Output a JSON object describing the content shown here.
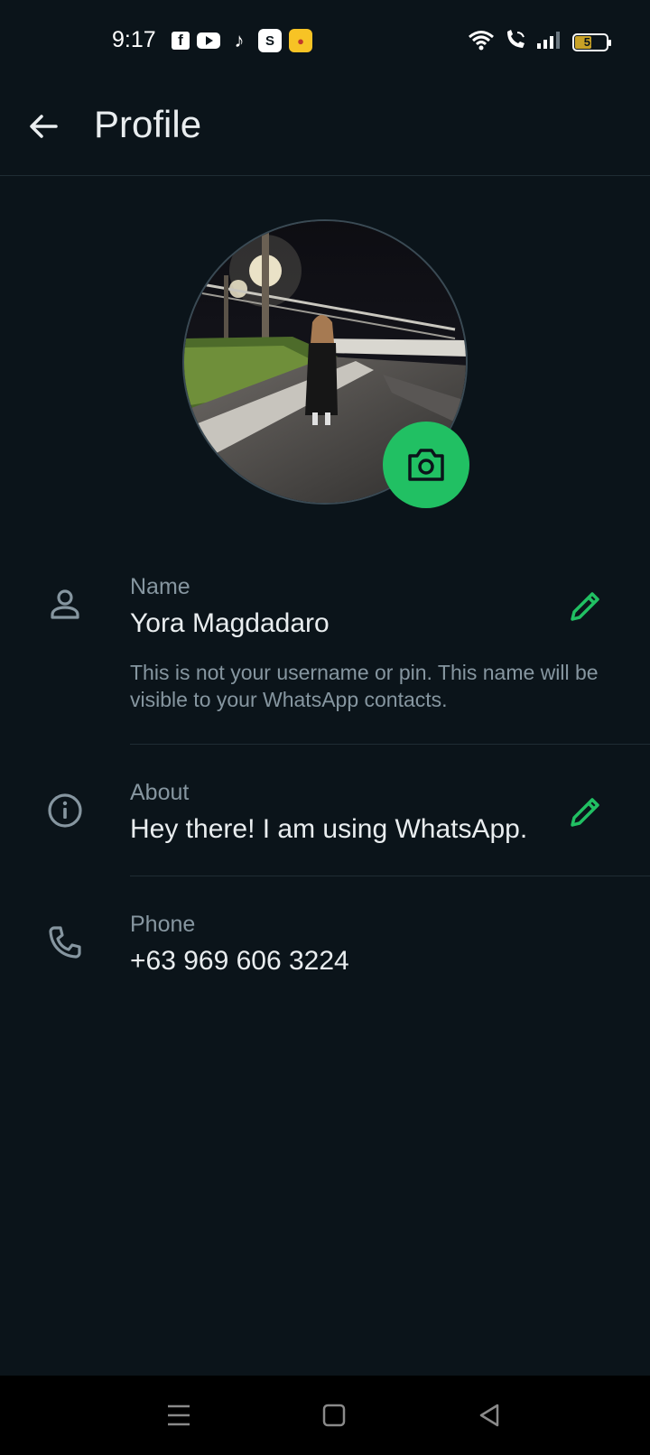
{
  "status_bar": {
    "time": "9:17",
    "notification_icons": [
      "facebook-icon",
      "youtube-icon",
      "tiktok-icon",
      "s-app-icon",
      "yellow-app-icon"
    ],
    "battery_level": "51",
    "accent_battery": "#c9a227"
  },
  "header": {
    "title": "Profile"
  },
  "profile": {
    "photo_alt": "Profile photo"
  },
  "rows": {
    "name": {
      "label": "Name",
      "value": "Yora Magdadaro",
      "help": "This is not your username or pin. This name will be visible to your WhatsApp contacts."
    },
    "about": {
      "label": "About",
      "value": "Hey there! I am using WhatsApp."
    },
    "phone": {
      "label": "Phone",
      "value": "+63 969 606 3224"
    }
  },
  "colors": {
    "background": "#0b141a",
    "accent": "#21c063",
    "secondary_text": "#8696a0",
    "primary_text": "#e9edef"
  }
}
